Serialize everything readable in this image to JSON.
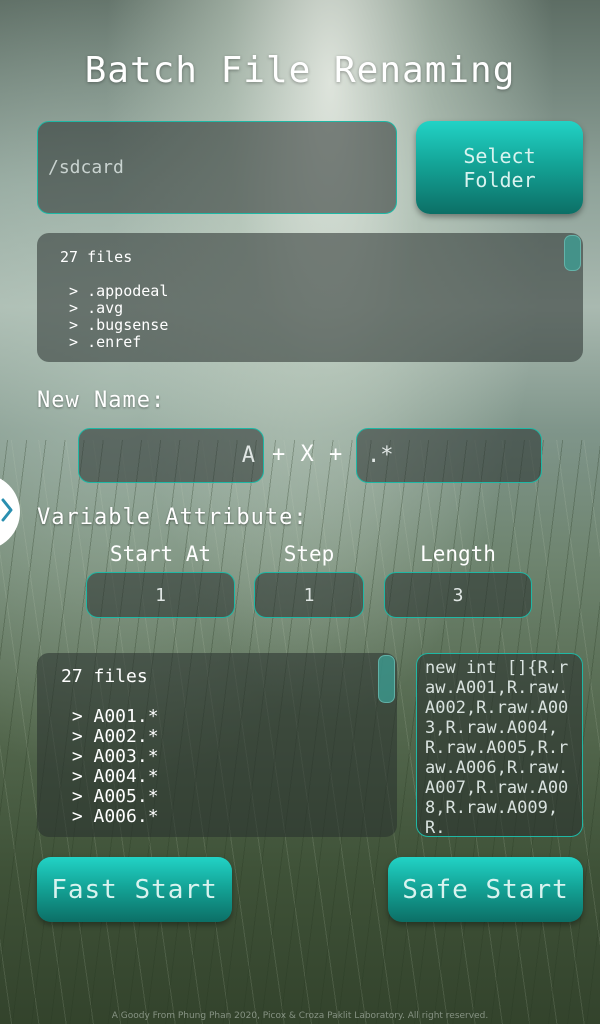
{
  "title": "Batch File Renaming",
  "folder": {
    "path": "/sdcard",
    "select_label_line1": "Select",
    "select_label_line2": "Folder"
  },
  "source_list": {
    "count": "27 files",
    "items": [
      " > .appodeal",
      " > .avg",
      " > .bugsense",
      " > .enref"
    ]
  },
  "new_name": {
    "label": "New Name:",
    "prefix": "A",
    "separator": "+ X +",
    "extension": ".*"
  },
  "variable_attribute": {
    "label": "Variable Attribute:",
    "start_at": {
      "label": "Start At",
      "value": "1"
    },
    "step": {
      "label": "Step",
      "value": "1"
    },
    "length": {
      "label": "Length",
      "value": "3"
    }
  },
  "preview_list": {
    "count": "27 files",
    "items": [
      " > A001.*",
      " > A002.*",
      " > A003.*",
      " > A004.*",
      " > A005.*",
      " > A006.*"
    ]
  },
  "code_output": "new int []{R.raw.A001,R.raw.A002,R.raw.A003,R.raw.A004,R.raw.A005,R.raw.A006,R.raw.A007,R.raw.A008,R.raw.A009,R.",
  "buttons": {
    "fast_start": "Fast Start",
    "safe_start": "Safe Start"
  },
  "side_tab_icon": "chevron-right-icon",
  "footer": "A Goody From Phung Phan 2020, Picox & Croza Paklit Laboratory. All right reserved.",
  "colors": {
    "accent": "#1fb7a4",
    "button_top": "#22d3c6",
    "button_bottom": "#0c6f66",
    "side_tab_chevron": "#2a8fb0"
  }
}
